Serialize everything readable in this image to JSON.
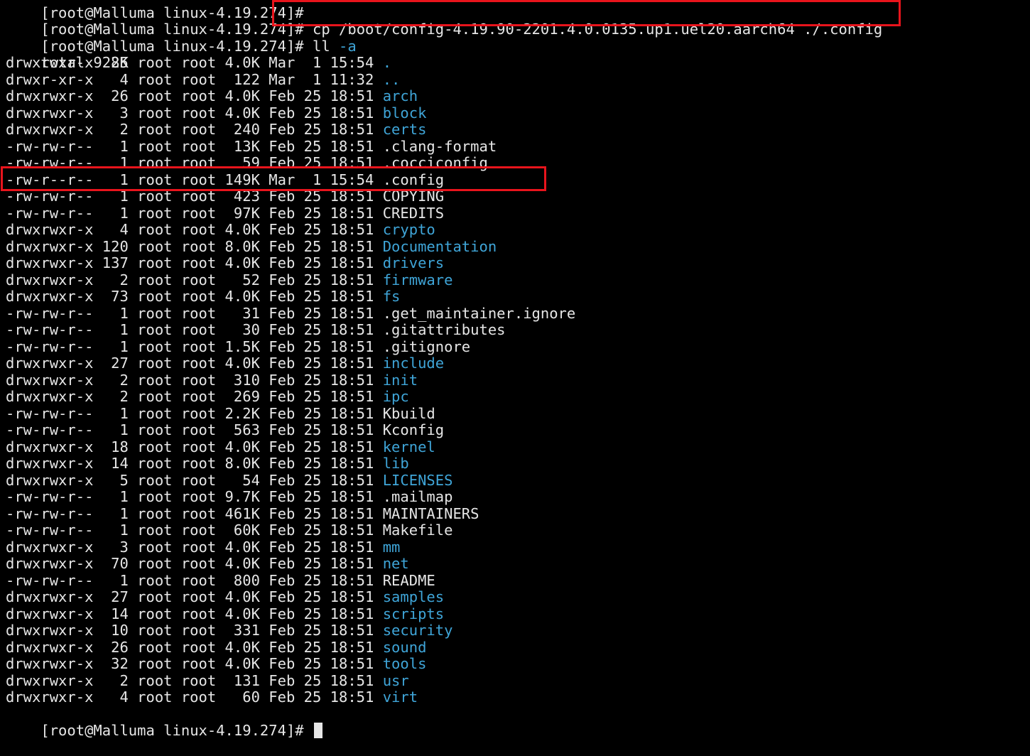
{
  "colors": {
    "background": "#000000",
    "foreground": "#e6e6e6",
    "directory": "#3fa5d8",
    "highlight_box": "#e8141c"
  },
  "terminal": {
    "top_line": "[root@Malluma linux-4.19.274]#",
    "commands": [
      {
        "prompt": "[root@Malluma linux-4.19.274]#",
        "command": " cp /boot/config-4.19.90-2201.4.0.0135.up1.uel20.aarch64 ./.config"
      },
      {
        "prompt": "[root@Malluma linux-4.19.274]#",
        "command": " ll",
        "arg": " -a"
      }
    ],
    "total": "total 928K",
    "entries": [
      {
        "meta": "drwxrwxr-x  25 root root 4.0K Mar  1 15:54 ",
        "name": ".",
        "type": "dir"
      },
      {
        "meta": "drwxr-xr-x   4 root root  122 Mar  1 11:32 ",
        "name": "..",
        "type": "dir"
      },
      {
        "meta": "drwxrwxr-x  26 root root 4.0K Feb 25 18:51 ",
        "name": "arch",
        "type": "dir"
      },
      {
        "meta": "drwxrwxr-x   3 root root 4.0K Feb 25 18:51 ",
        "name": "block",
        "type": "dir"
      },
      {
        "meta": "drwxrwxr-x   2 root root  240 Feb 25 18:51 ",
        "name": "certs",
        "type": "dir"
      },
      {
        "meta": "-rw-rw-r--   1 root root  13K Feb 25 18:51 ",
        "name": ".clang-format",
        "type": "file"
      },
      {
        "meta": "-rw-rw-r--   1 root root   59 Feb 25 18:51 ",
        "name": ".cocciconfig",
        "type": "file"
      },
      {
        "meta": "-rw-r--r--   1 root root 149K Mar  1 15:54 ",
        "name": ".config",
        "type": "file"
      },
      {
        "meta": "-rw-rw-r--   1 root root  423 Feb 25 18:51 ",
        "name": "COPYING",
        "type": "file"
      },
      {
        "meta": "-rw-rw-r--   1 root root  97K Feb 25 18:51 ",
        "name": "CREDITS",
        "type": "file"
      },
      {
        "meta": "drwxrwxr-x   4 root root 4.0K Feb 25 18:51 ",
        "name": "crypto",
        "type": "dir"
      },
      {
        "meta": "drwxrwxr-x 120 root root 8.0K Feb 25 18:51 ",
        "name": "Documentation",
        "type": "dir"
      },
      {
        "meta": "drwxrwxr-x 137 root root 4.0K Feb 25 18:51 ",
        "name": "drivers",
        "type": "dir"
      },
      {
        "meta": "drwxrwxr-x   2 root root   52 Feb 25 18:51 ",
        "name": "firmware",
        "type": "dir"
      },
      {
        "meta": "drwxrwxr-x  73 root root 4.0K Feb 25 18:51 ",
        "name": "fs",
        "type": "dir"
      },
      {
        "meta": "-rw-rw-r--   1 root root   31 Feb 25 18:51 ",
        "name": ".get_maintainer.ignore",
        "type": "file"
      },
      {
        "meta": "-rw-rw-r--   1 root root   30 Feb 25 18:51 ",
        "name": ".gitattributes",
        "type": "file"
      },
      {
        "meta": "-rw-rw-r--   1 root root 1.5K Feb 25 18:51 ",
        "name": ".gitignore",
        "type": "file"
      },
      {
        "meta": "drwxrwxr-x  27 root root 4.0K Feb 25 18:51 ",
        "name": "include",
        "type": "dir"
      },
      {
        "meta": "drwxrwxr-x   2 root root  310 Feb 25 18:51 ",
        "name": "init",
        "type": "dir"
      },
      {
        "meta": "drwxrwxr-x   2 root root  269 Feb 25 18:51 ",
        "name": "ipc",
        "type": "dir"
      },
      {
        "meta": "-rw-rw-r--   1 root root 2.2K Feb 25 18:51 ",
        "name": "Kbuild",
        "type": "file"
      },
      {
        "meta": "-rw-rw-r--   1 root root  563 Feb 25 18:51 ",
        "name": "Kconfig",
        "type": "file"
      },
      {
        "meta": "drwxrwxr-x  18 root root 4.0K Feb 25 18:51 ",
        "name": "kernel",
        "type": "dir"
      },
      {
        "meta": "drwxrwxr-x  14 root root 8.0K Feb 25 18:51 ",
        "name": "lib",
        "type": "dir"
      },
      {
        "meta": "drwxrwxr-x   5 root root   54 Feb 25 18:51 ",
        "name": "LICENSES",
        "type": "dir"
      },
      {
        "meta": "-rw-rw-r--   1 root root 9.7K Feb 25 18:51 ",
        "name": ".mailmap",
        "type": "file"
      },
      {
        "meta": "-rw-rw-r--   1 root root 461K Feb 25 18:51 ",
        "name": "MAINTAINERS",
        "type": "file"
      },
      {
        "meta": "-rw-rw-r--   1 root root  60K Feb 25 18:51 ",
        "name": "Makefile",
        "type": "file"
      },
      {
        "meta": "drwxrwxr-x   3 root root 4.0K Feb 25 18:51 ",
        "name": "mm",
        "type": "dir"
      },
      {
        "meta": "drwxrwxr-x  70 root root 4.0K Feb 25 18:51 ",
        "name": "net",
        "type": "dir"
      },
      {
        "meta": "-rw-rw-r--   1 root root  800 Feb 25 18:51 ",
        "name": "README",
        "type": "file"
      },
      {
        "meta": "drwxrwxr-x  27 root root 4.0K Feb 25 18:51 ",
        "name": "samples",
        "type": "dir"
      },
      {
        "meta": "drwxrwxr-x  14 root root 4.0K Feb 25 18:51 ",
        "name": "scripts",
        "type": "dir"
      },
      {
        "meta": "drwxrwxr-x  10 root root  331 Feb 25 18:51 ",
        "name": "security",
        "type": "dir"
      },
      {
        "meta": "drwxrwxr-x  26 root root 4.0K Feb 25 18:51 ",
        "name": "sound",
        "type": "dir"
      },
      {
        "meta": "drwxrwxr-x  32 root root 4.0K Feb 25 18:51 ",
        "name": "tools",
        "type": "dir"
      },
      {
        "meta": "drwxrwxr-x   2 root root  131 Feb 25 18:51 ",
        "name": "usr",
        "type": "dir"
      },
      {
        "meta": "drwxrwxr-x   4 root root   60 Feb 25 18:51 ",
        "name": "virt",
        "type": "dir"
      }
    ],
    "final_prompt": "[root@Malluma linux-4.19.274]#"
  }
}
